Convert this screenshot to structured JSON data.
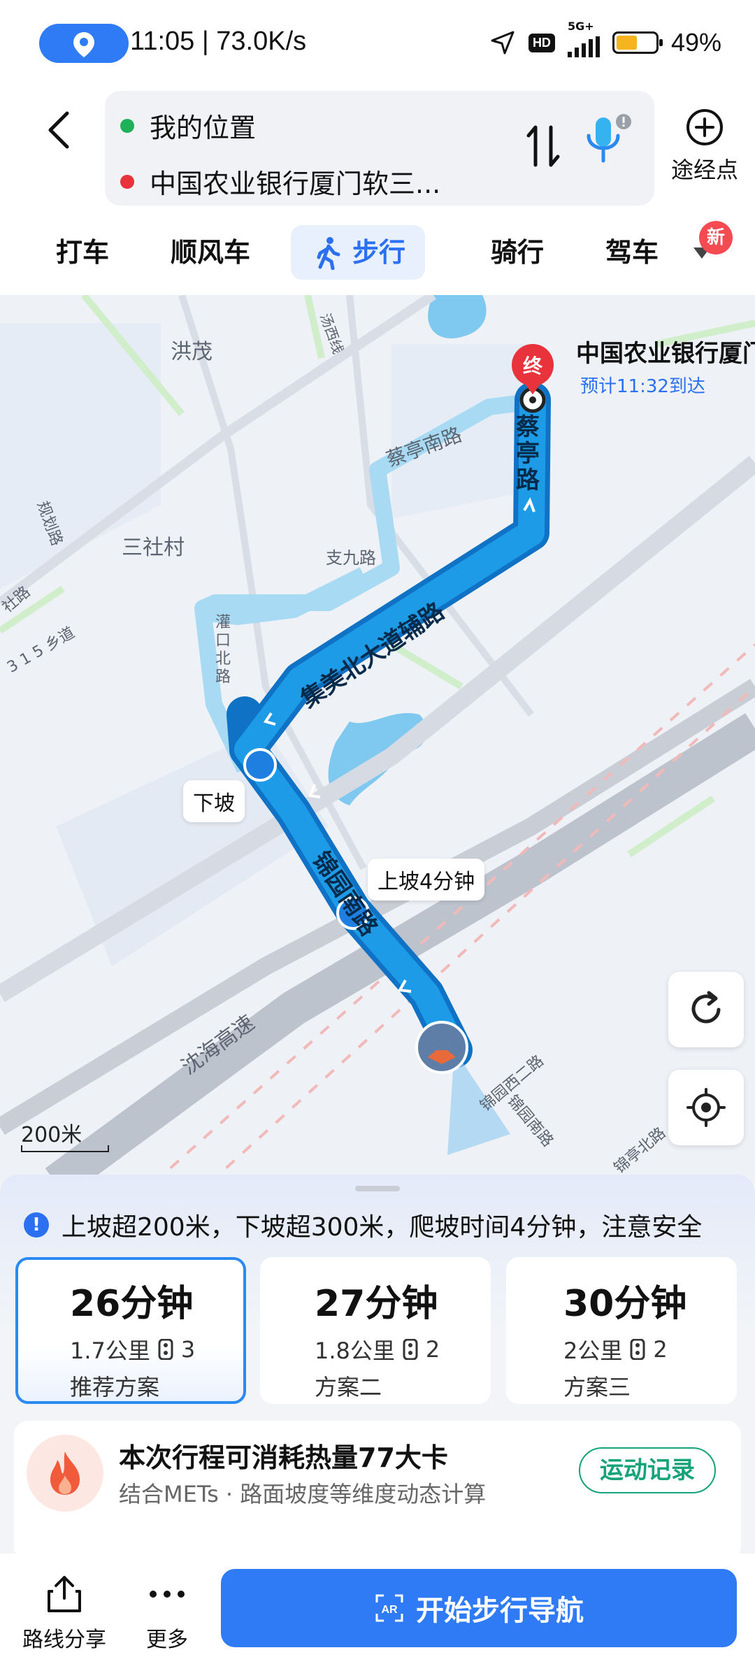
{
  "status_bar": {
    "time_speed": "11:05 | 73.0K/s",
    "network": "5G+",
    "hd": "HD",
    "battery_percent": 49,
    "battery_label": "49%"
  },
  "header": {
    "origin": "我的位置",
    "destination": "中国农业银行厦门软三...",
    "waypoint_label": "途经点",
    "colors": {
      "origin_dot": "#1fb05a",
      "destination_dot": "#e8323c"
    }
  },
  "tabs": [
    {
      "label": "打车",
      "active": false
    },
    {
      "label": "顺风车",
      "active": false
    },
    {
      "label": "步行",
      "active": true
    },
    {
      "label": "骑行",
      "active": false
    },
    {
      "label": "驾车",
      "active": false
    }
  ],
  "new_badge": "新",
  "map": {
    "place_labels": [
      "洪茂",
      "三社村",
      "支九路",
      "灌口北路",
      "沈海高速",
      "蔡亭南路",
      "汤西线",
      "规划路",
      "3 1 5 乡道",
      "锦园西二路",
      "锦园南路",
      "锦亭北路",
      "社路"
    ],
    "route_labels": [
      "集美北大道辅路",
      "蔡亭路",
      "锦园南路"
    ],
    "callouts": {
      "downhill": "下坡",
      "uphill": "上坡4分钟"
    },
    "end_marker": "终",
    "destination_name": "中国农业银行厦门",
    "eta": "预计11:32到达",
    "scale": "200米"
  },
  "notice": "上坡超200米，下坡超300米，爬坡时间4分钟，注意安全",
  "plans": [
    {
      "time": "26分钟",
      "distance": "1.7公里",
      "lights": "3",
      "name": "推荐方案",
      "selected": true
    },
    {
      "time": "27分钟",
      "distance": "1.8公里",
      "lights": "2",
      "name": "方案二",
      "selected": false
    },
    {
      "time": "30分钟",
      "distance": "2公里",
      "lights": "2",
      "name": "方案三",
      "selected": false
    }
  ],
  "calorie": {
    "title": "本次行程可消耗热量77大卡",
    "subtitle": "结合METs · 路面坡度等维度动态计算",
    "button": "运动记录"
  },
  "bottom": {
    "share_label": "路线分享",
    "more_label": "更多",
    "start_label": "开始步行导航"
  },
  "colors": {
    "accent": "#2f7bf6",
    "route": "#1e9be6",
    "alt_route": "#9fd3ee",
    "green": "#17a37a"
  }
}
